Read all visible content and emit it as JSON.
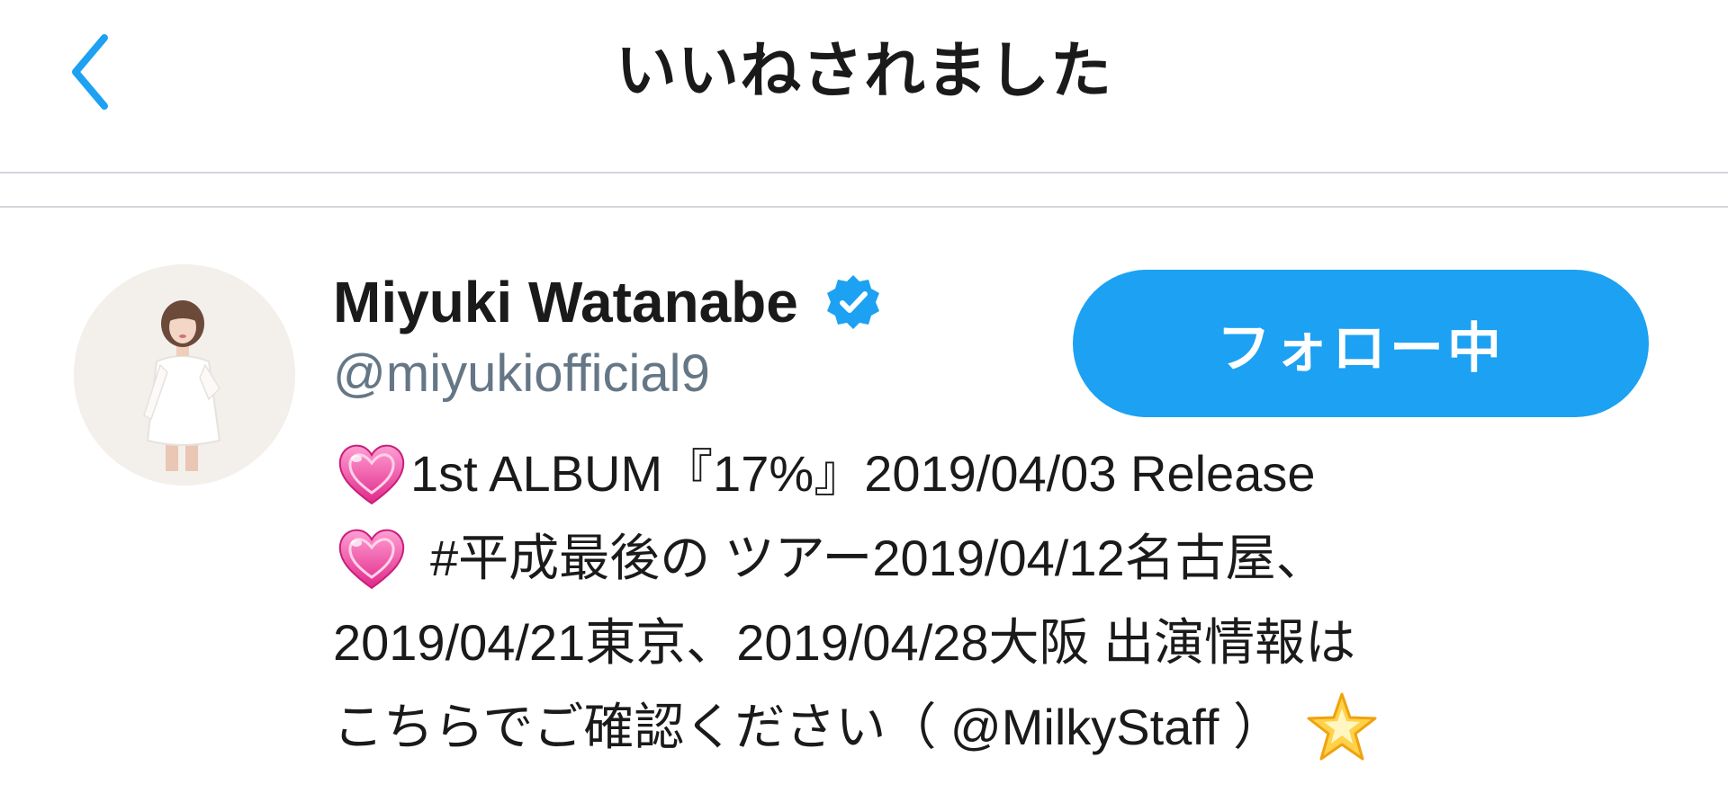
{
  "header": {
    "title": "いいねされました",
    "back_icon": "chevron-left-icon"
  },
  "user": {
    "display_name": "Miyuki Watanabe",
    "verified_icon": "verified-badge-icon",
    "handle": "@miyukiofficial9",
    "follow_button_label": "フォロー中",
    "avatar_icon": "avatar"
  },
  "bio": {
    "line1_emoji": "heart-icon",
    "line1_text": "1st ALBUM『17%』2019/04/03 Release",
    "line2_emoji": "heart-icon",
    "line2_text": "#平成最後の ツアー2019/04/12名古屋、",
    "line3_text": "2019/04/21東京、2019/04/28大阪 出演情報は",
    "line4_text": "こちらでご確認ください（ @MilkyStaff ）",
    "line4_emoji": "glowing-star-icon"
  },
  "colors": {
    "accent": "#1da1f2",
    "handle": "#657786",
    "divider": "#d3d6db",
    "text": "#1a1a1a",
    "heart": "#e8409b"
  }
}
